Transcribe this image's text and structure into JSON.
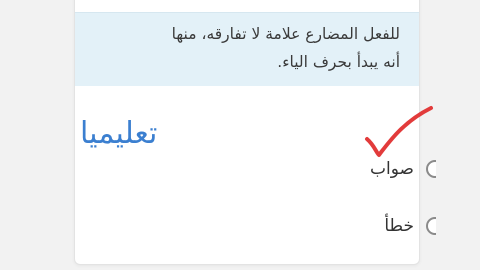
{
  "question": {
    "line1": "للفعل المضارع علامة لا تفارقه، منها",
    "line2": "أنه يبدأ بحرف الياء."
  },
  "options": [
    {
      "label": "صواب",
      "selected": false
    },
    {
      "label": "خطأ",
      "selected": false
    }
  ],
  "watermark": {
    "text": "تعليميا"
  },
  "annotation": {
    "mark": "checkmark-icon",
    "color": "#e23b3b"
  },
  "colors": {
    "question_bg": "#e3f1f8",
    "watermark": "#3b7fd0"
  }
}
